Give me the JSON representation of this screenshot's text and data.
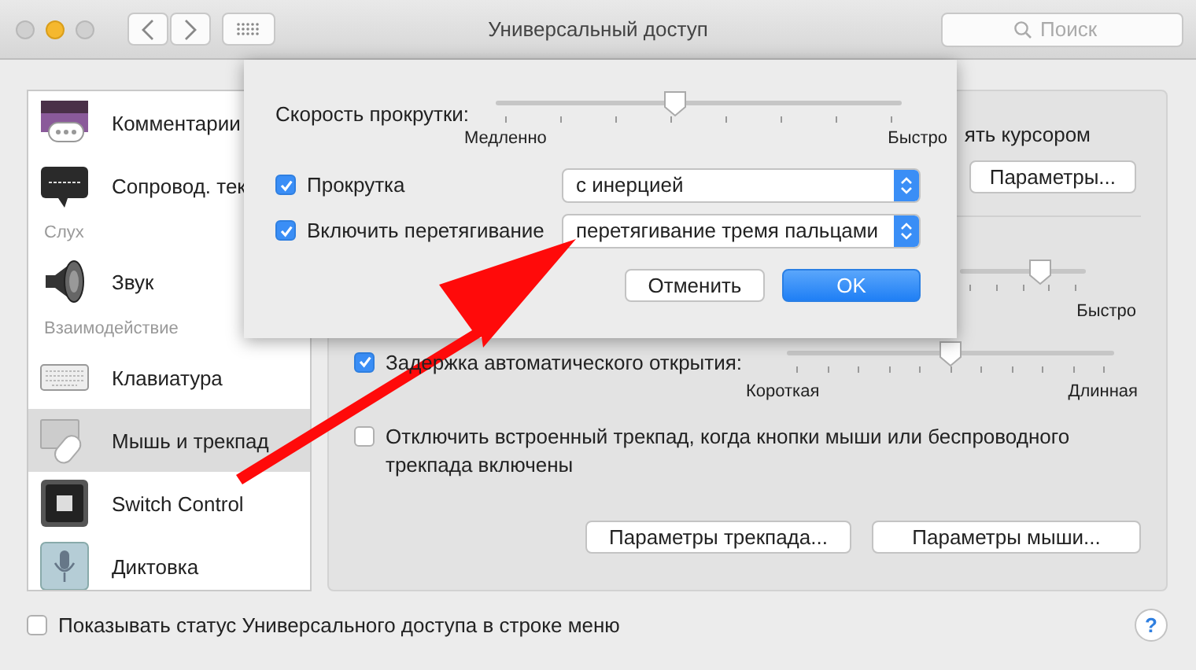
{
  "window": {
    "title": "Универсальный доступ",
    "search": {
      "placeholder": "Поиск"
    }
  },
  "sidebar": {
    "items": [
      {
        "kind": "item",
        "label": "Комментарии",
        "selected": false
      },
      {
        "kind": "item",
        "label": "Сопровод. тек",
        "selected": false
      },
      {
        "kind": "header",
        "label": "Слух"
      },
      {
        "kind": "item",
        "label": "Звук",
        "selected": false
      },
      {
        "kind": "header",
        "label": "Взаимодействие"
      },
      {
        "kind": "item",
        "label": "Клавиатура",
        "selected": false
      },
      {
        "kind": "item",
        "label": "Мышь и трекпад",
        "selected": true
      },
      {
        "kind": "item",
        "label": "Switch Control",
        "selected": false
      },
      {
        "kind": "item",
        "label": "Диктовка",
        "selected": false
      }
    ]
  },
  "main": {
    "partial_label": "ять курсором",
    "options_button": "Параметры...",
    "speed_slider": {
      "level": 0.64,
      "max_label": "Быстро"
    },
    "delay": {
      "checked": true,
      "label": "Задержка автоматического открытия:",
      "level": 0.5,
      "min_label": "Короткая",
      "max_label": "Длинная"
    },
    "disable_trackpad": {
      "checked": false,
      "label": "Отключить встроенный трекпад, когда кнопки мыши или беспроводного трекпада включены"
    },
    "buttons": [
      "Параметры трекпада...",
      "Параметры мыши..."
    ]
  },
  "bottom": {
    "checked": false,
    "label": "Показывать статус Универсального доступа в строке меню",
    "help": "?"
  },
  "sheet": {
    "scroll_speed": {
      "label": "Скорость прокрутки:",
      "level": 0.44,
      "min_label": "Медленно",
      "max_label": "Быстро"
    },
    "rows": [
      {
        "checked": true,
        "label": "Прокрутка",
        "value": "с инерцией"
      },
      {
        "checked": true,
        "label": "Включить перетягивание",
        "value": "перетягивание тремя пальцами"
      }
    ],
    "cancel": "Отменить",
    "ok": "OK"
  }
}
